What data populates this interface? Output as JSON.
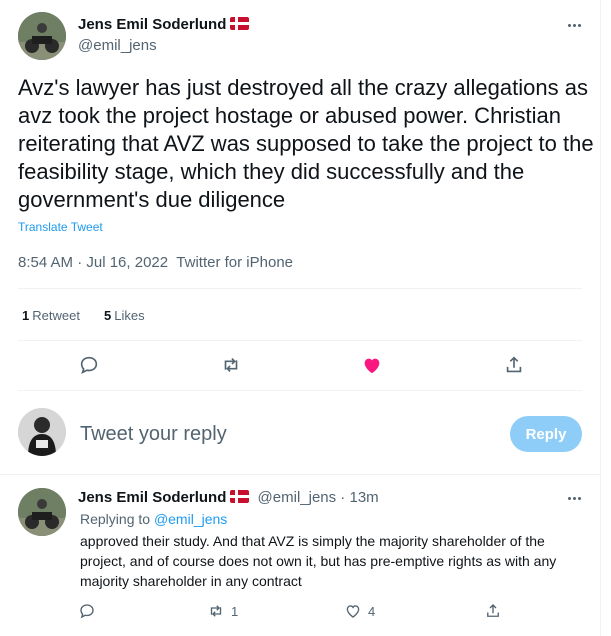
{
  "tweet": {
    "author_name": "Jens Emil Soderlund",
    "author_handle": "@emil_jens",
    "text": "Avz's lawyer has just destroyed all the crazy allegations as avz took the project hostage or abused power. Christian reiterating that AVZ was supposed to take the project to the feasibility stage, which they did successfully and the government's due diligence",
    "translate_label": "Translate Tweet",
    "time": "8:54 AM · Jul 16, 2022",
    "source": "Twitter for iPhone",
    "retweets_count": "1",
    "retweets_label": "Retweet",
    "likes_count": "5",
    "likes_label": "Likes"
  },
  "compose": {
    "placeholder": "Tweet your reply",
    "button_label": "Reply"
  },
  "reply": {
    "author_name": "Jens Emil Soderlund",
    "author_handle": "@emil_jens",
    "time_ago": "13m",
    "replying_to_label": "Replying to",
    "replying_to_handle": "@emil_jens",
    "text": "approved their study. And that AVZ is simply the majority shareholder of the project, and of course does not own it, but has pre-emptive rights as with any majority shareholder in any contract",
    "retweets": "1",
    "likes": "4"
  },
  "icons": {
    "reply": "reply-icon",
    "retweet": "retweet-icon",
    "like": "heart-icon",
    "share": "share-icon",
    "more": "more-icon",
    "flag": "denmark-flag-icon"
  },
  "colors": {
    "accent": "#1d9bf0",
    "like_active": "#f91880",
    "reply_button_disabled": "#8ecdf8",
    "muted_text": "#536471"
  }
}
